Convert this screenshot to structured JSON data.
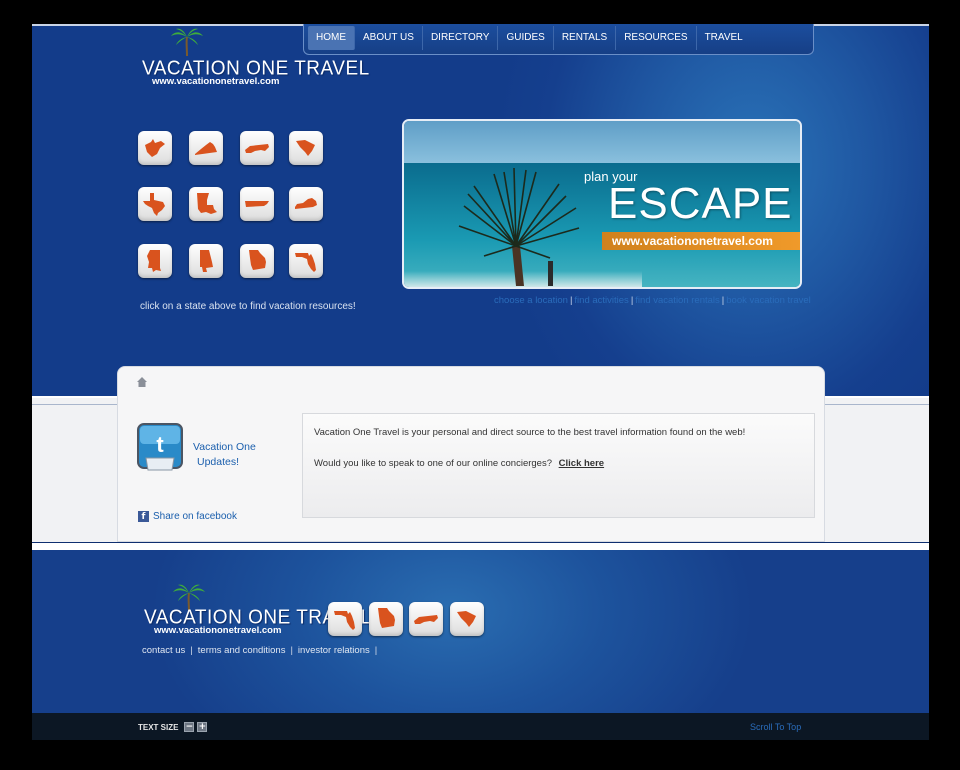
{
  "site": {
    "name": "VACATION ONE TRAVEL",
    "url": "www.vacationonetravel.com"
  },
  "nav": {
    "items": [
      "HOME",
      "ABOUT US",
      "DIRECTORY",
      "GUIDES",
      "RENTALS",
      "RESOURCES",
      "TRAVEL"
    ],
    "active": "HOME"
  },
  "states": {
    "hint": "click on a state above to find vacation resources!",
    "names": [
      "West Virginia",
      "Virginia",
      "North Carolina",
      "South Carolina",
      "Texas",
      "Louisiana",
      "Tennessee",
      "Kentucky",
      "Mississippi",
      "Alabama",
      "Georgia",
      "Florida"
    ],
    "shape_color": "#d9531e"
  },
  "banner": {
    "tagline": "plan your",
    "headline": "ESCAPE",
    "url": "www.vacationonetravel.com"
  },
  "banner_links": [
    "choose a location",
    "find activities",
    "find vacation rentals",
    "book vacation travel"
  ],
  "content": {
    "twitter_line1": "Vacation One",
    "twitter_line2": "Updates!",
    "facebook_label": "Share on facebook",
    "intro": "Vacation One Travel is your personal and direct source to the best travel information found on the web!",
    "concierge_question": "Would you like to speak to one of our online concierges?",
    "concierge_link": "Click here"
  },
  "footer": {
    "links": [
      "contact us",
      "terms and conditions",
      "investor relations"
    ],
    "state_names": [
      "Florida",
      "Georgia",
      "North Carolina",
      "South Carolina"
    ]
  },
  "bottom_bar": {
    "text_size_label": "TEXT SIZE",
    "decrease": "−",
    "increase": "+",
    "scroll_top": "Scroll To Top"
  },
  "colors": {
    "brand_blue": "#153f8e",
    "accent_orange": "#f09a2a",
    "link_blue": "#2a6cbb"
  }
}
